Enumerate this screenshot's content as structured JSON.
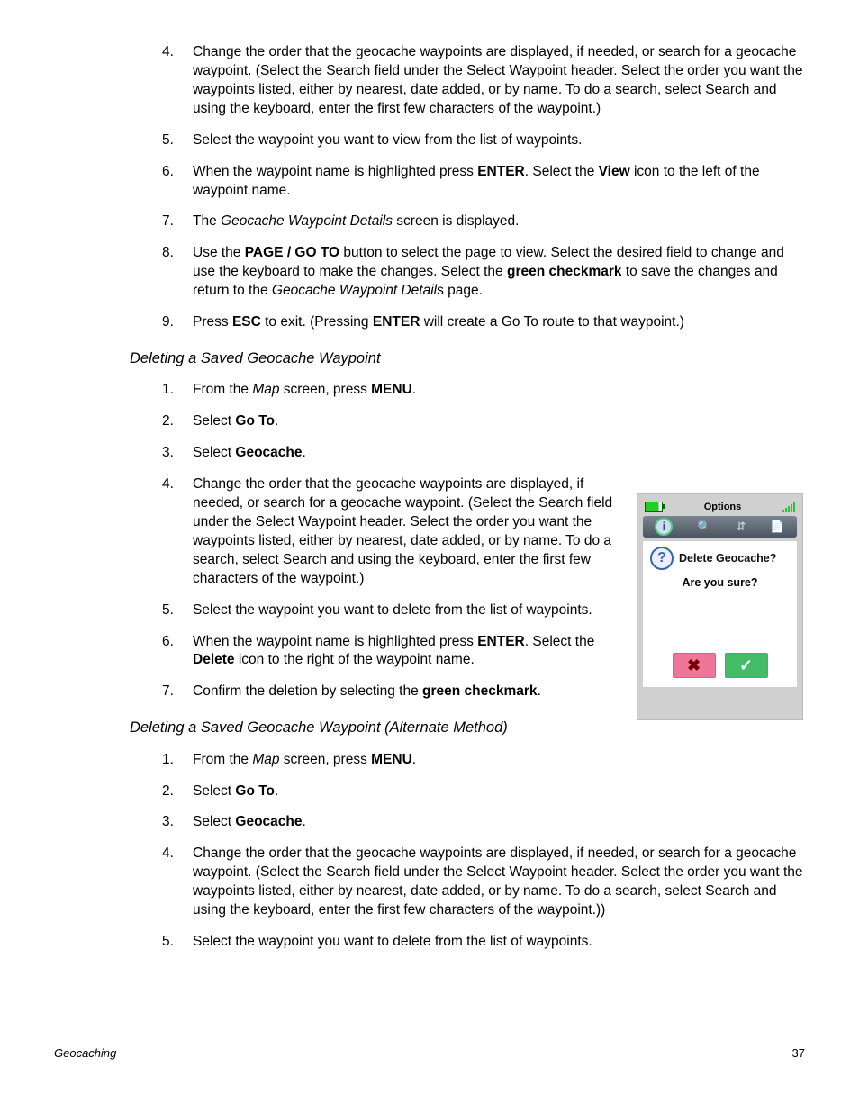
{
  "sectionA": {
    "items": [
      {
        "n": "4.",
        "html": "Change the order that the geocache waypoints are displayed, if needed, or search for a geocache waypoint.  (Select the Search field under the Select Waypoint header.  Select the order you want the waypoints listed, either by nearest, date added, or by name.  To do a search, select Search and using the keyboard, enter the first few characters of the waypoint.)"
      },
      {
        "n": "5.",
        "html": "Select the waypoint you want to view from the list of waypoints."
      },
      {
        "n": "6.",
        "html": "When the waypoint name is highlighted press <b>ENTER</b>.  Select the <b>View</b> icon to the left of the waypoint name."
      },
      {
        "n": "7.",
        "html": "The <i>Geocache Waypoint Details</i> screen is displayed."
      },
      {
        "n": "8.",
        "html": "Use the <b>PAGE / GO TO</b> button to select the page to view.  Select the desired field to change and use the keyboard to make the changes.  Select the <b>green checkmark</b> to save the changes and return to the <i>Geocache Waypoint Detail</i>s page."
      },
      {
        "n": "9.",
        "html": "Press <b>ESC</b> to exit.  (Pressing <b>ENTER</b> will create a Go To route to that waypoint.)"
      }
    ]
  },
  "headingB": "Deleting a Saved Geocache Waypoint",
  "sectionB": {
    "items": [
      {
        "n": "1.",
        "html": "From the <i>Map</i> screen, press <b>MENU</b>."
      },
      {
        "n": "2.",
        "html": "Select <b>Go To</b>."
      },
      {
        "n": "3.",
        "html": "Select <b>Geocache</b>."
      },
      {
        "n": "4.",
        "html": "Change the order that the geocache waypoints are displayed, if needed, or search for a geocache waypoint. (Select the Search field under the Select Waypoint header.  Select the order you want the waypoints listed, either by nearest, date added, or by name.  To do a search, select Search and using the keyboard, enter the first few characters of the waypoint.)"
      },
      {
        "n": "5.",
        "html": "Select the waypoint you want to delete from the list of waypoints."
      },
      {
        "n": "6.",
        "html": "When the waypoint name is highlighted press <b>ENTER</b>.  Select the <b>Delete</b> icon to the right of the waypoint name."
      },
      {
        "n": "7.",
        "html": "Confirm the deletion by selecting the <b>green checkmark</b>."
      }
    ]
  },
  "headingC": "Deleting a Saved Geocache Waypoint (Alternate Method)",
  "sectionC": {
    "items": [
      {
        "n": "1.",
        "html": "From the <i>Map</i> screen, press <b>MENU</b>."
      },
      {
        "n": "2.",
        "html": "Select <b>Go To</b>."
      },
      {
        "n": "3.",
        "html": "Select <b>Geocache</b>."
      },
      {
        "n": "4.",
        "html": "Change the order that the geocache waypoints are displayed, if needed, or search for a geocache waypoint.  (Select the Search field under the Select Waypoint header.  Select the order you want the waypoints listed, either by nearest, date added, or by name.  To do a search, select Search and using the keyboard, enter the first few characters of the waypoint.))"
      },
      {
        "n": "5.",
        "html": "Select the waypoint you want to delete from the list of waypoints."
      }
    ]
  },
  "device": {
    "options": "Options",
    "dialog_title": "Delete Geocache?",
    "dialog_question": "Are you sure?",
    "no_glyph": "✖",
    "yes_glyph": "✓"
  },
  "footer": {
    "section": "Geocaching",
    "page": "37"
  }
}
